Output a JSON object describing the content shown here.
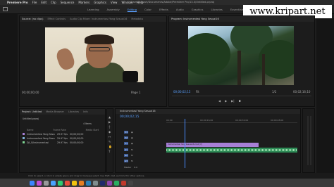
{
  "menubar": {
    "app": "Premiere Pro",
    "items": [
      "File",
      "Edit",
      "Clip",
      "Sequence",
      "Markers",
      "Graphics",
      "View",
      "Window",
      "Help"
    ],
    "path": "/Users/kripart/Documents/Adobe/Premiere Pro/13.0/Untitled.prproj"
  },
  "workspaces": [
    "Learning",
    "Assembly",
    "Editing",
    "Color",
    "Effects",
    "Audio",
    "Graphics",
    "Libraries",
    "Essentials"
  ],
  "watermark": "www.kripart.net",
  "source_panel": {
    "tabs": [
      "Source: (no clips)",
      "Effect Controls",
      "Audio Clip Mixer: Instrumentasi Yang Sesuai16",
      "Metadata"
    ],
    "timecode_left": "00;00;00;00",
    "page_label": "Page 1"
  },
  "program_panel": {
    "tab": "Program: Instrumentasi Yang Sesuai16",
    "timecode_left": "00;00;02;15",
    "fit": "Fit",
    "zoom": "1/2",
    "timecode_right": "00;02;16;10"
  },
  "project_panel": {
    "tabs": [
      "Project: Untitled",
      "Media Browser",
      "Libraries",
      "Info"
    ],
    "file": "Untitled.prproj",
    "items_count": "4 Items",
    "columns": [
      "Name",
      "Frame Rate",
      "Media Start"
    ],
    "rows": [
      {
        "name": "Instrumentasi Yang Sesuai16",
        "rate": "29.97 fps",
        "start": "00;00;00;00"
      },
      {
        "name": "Instrumentasi Yang Sesuai16",
        "rate": "29.97 fps",
        "start": "00;00;00;00"
      },
      {
        "name": "DJI_0/Instrumentasi",
        "rate": "29.97 fps",
        "start": "00;00;00;00"
      }
    ]
  },
  "timeline": {
    "tab": "Instrumentasi Yang Sesuai16",
    "timecode": "00;00;02;15",
    "ruler": [
      "00;00",
      "00;00;16;00",
      "00;00;32;00",
      "00;00;48;00"
    ],
    "video_tracks": [
      "V3",
      "V2",
      "V1"
    ],
    "audio_tracks": [
      "A1",
      "A2",
      "A3"
    ],
    "clip_name": "Instrumentasi Yang Sesuai16.mp4 [V]",
    "master": "Master",
    "master_value": "0.0"
  },
  "status": "Click to select, or click in empty space and drag to marquee select. Use Shift, Opt, and Cmd for other options.",
  "colors": {
    "accent": "#5aa0ff",
    "clip_video": "#a77fd6",
    "clip_audio": "#2e8c57"
  }
}
